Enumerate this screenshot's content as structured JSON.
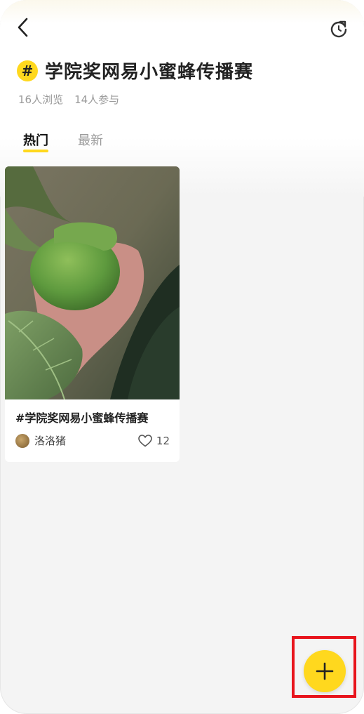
{
  "header": {
    "back_icon": "chevron-left-icon",
    "refresh_icon": "refresh-icon"
  },
  "topic": {
    "hash_symbol": "#",
    "title": "学院奖网易小蜜蜂传播赛",
    "views": "16人浏览",
    "participants": "14人参与"
  },
  "tabs": [
    {
      "label": "热门",
      "active": true
    },
    {
      "label": "最新",
      "active": false
    }
  ],
  "posts": [
    {
      "title": "#学院奖网易小蜜蜂传播赛",
      "author": "洛洛猪",
      "likes": "12",
      "image_description_icon": "photo-persimmon"
    }
  ],
  "fab": {
    "icon": "plus-icon"
  },
  "colors": {
    "accent": "#ffd81e",
    "highlight": "#e8141c",
    "background": "#f4f4f4"
  }
}
